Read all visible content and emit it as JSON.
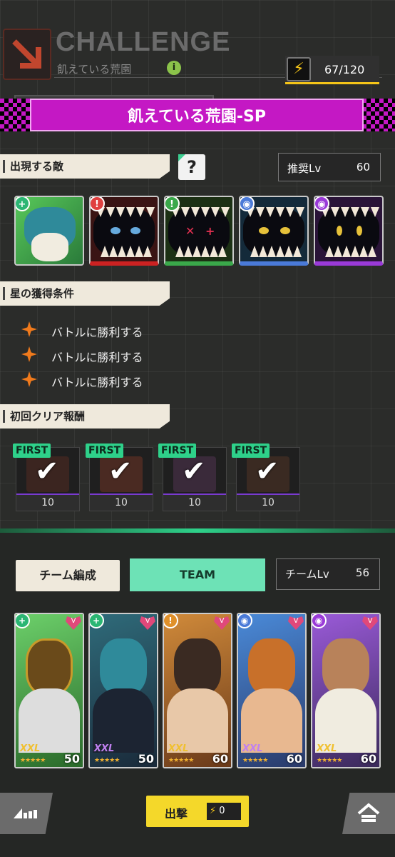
{
  "header": {
    "title": "CHALLENGE",
    "subtitle": "飢えている荒園",
    "info_icon": "i",
    "stamina_icon": "lightning-icon",
    "stamina": "67/120"
  },
  "stage": {
    "name": "飢えている荒園-SP",
    "color": "#c418c4"
  },
  "enemies_section": {
    "label": "出現する敵",
    "help": "?",
    "recommended_label": "推奨Lv",
    "recommended_value": "60",
    "enemies": [
      {
        "type_icon": "+",
        "type_color": "#2bb673"
      },
      {
        "type_icon": "!",
        "type_color": "#e04040"
      },
      {
        "type_icon": "!",
        "type_color": "#3aa84a"
      },
      {
        "type_icon": "◉",
        "type_color": "#4a7ad8"
      },
      {
        "type_icon": "◉",
        "type_color": "#9a3ad8"
      }
    ]
  },
  "conditions_section": {
    "label": "星の獲得条件",
    "items": [
      "バトルに勝利する",
      "バトルに勝利する",
      "バトルに勝利する"
    ]
  },
  "rewards_section": {
    "label": "初回クリア報酬",
    "items": [
      {
        "badge": "FIRST",
        "count": "10"
      },
      {
        "badge": "FIRST",
        "count": "10"
      },
      {
        "badge": "FIRST",
        "count": "10"
      },
      {
        "badge": "FIRST",
        "count": "10"
      }
    ]
  },
  "team": {
    "edit_button": "チーム編成",
    "team_name": "TEAM",
    "team_lv_label": "チームLv",
    "team_lv_value": "56",
    "members": [
      {
        "level": "50",
        "rank": "XXL",
        "type_icon": "+",
        "type_color": "#2bb673",
        "heart": "V"
      },
      {
        "level": "50",
        "rank": "XXL",
        "type_icon": "+",
        "type_color": "#2bb673",
        "heart": "V"
      },
      {
        "level": "60",
        "rank": "XXL",
        "type_icon": "!",
        "type_color": "#e0902a",
        "heart": "V"
      },
      {
        "level": "60",
        "rank": "XXL",
        "type_icon": "◉",
        "type_color": "#4a7ad8",
        "heart": "V"
      },
      {
        "level": "60",
        "rank": "XXL",
        "type_icon": "◉",
        "type_color": "#9a3ad8",
        "heart": "V"
      }
    ]
  },
  "footer": {
    "sortie_button": "出撃",
    "sortie_cost": "0"
  }
}
